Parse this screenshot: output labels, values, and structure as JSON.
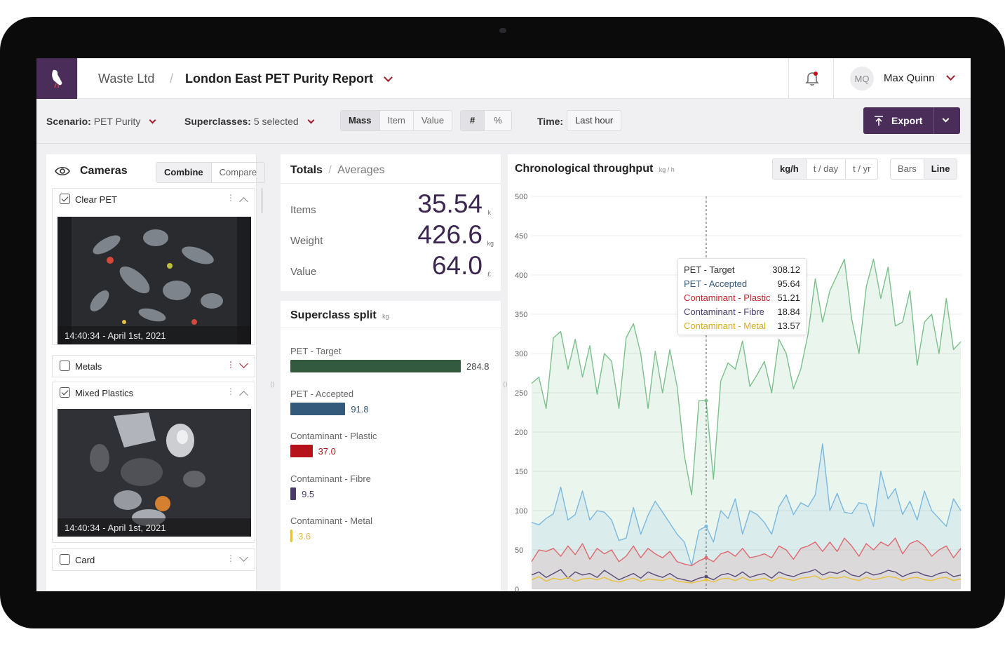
{
  "header": {
    "org": "Waste Ltd",
    "separator": "/",
    "report_title": "London East PET Purity Report",
    "user_initials": "MQ",
    "user_name": "Max Quinn"
  },
  "filters": {
    "scenario_label": "Scenario:",
    "scenario_value": "PET Purity",
    "superclasses_label": "Superclasses:",
    "superclasses_value": "5 selected",
    "metric_options": [
      "Mass",
      "Item",
      "Value"
    ],
    "metric_selected": "Mass",
    "unit_options": [
      "#",
      "%"
    ],
    "unit_selected": "#",
    "time_label": "Time:",
    "time_value": "Last hour",
    "export_label": "Export"
  },
  "cameras": {
    "title": "Cameras",
    "mode_options": [
      "Combine",
      "Compare"
    ],
    "mode_selected": "Combine",
    "items": [
      {
        "name": "Clear PET",
        "checked": true,
        "expanded": true,
        "timestamp": "14:40:34 - April 1st, 2021"
      },
      {
        "name": "Metals",
        "checked": false,
        "expanded": false
      },
      {
        "name": "Mixed Plastics",
        "checked": true,
        "expanded": true,
        "timestamp": "14:40:34 - April 1st, 2021"
      },
      {
        "name": "Card",
        "checked": false,
        "expanded": false
      }
    ]
  },
  "totals": {
    "tab_active": "Totals",
    "tab_separator": "/",
    "tab_inactive": "Averages",
    "rows": [
      {
        "label": "Items",
        "value": "35.54",
        "unit": "k"
      },
      {
        "label": "Weight",
        "value": "426.6",
        "unit": "kg"
      },
      {
        "label": "Value",
        "value": "64.0",
        "unit": "£"
      }
    ]
  },
  "superclass_split": {
    "title": "Superclass split",
    "unit": "kg",
    "max": 284.8,
    "items": [
      {
        "name": "PET - Target",
        "value": 284.8,
        "label": "284.8",
        "color": "#335a3f",
        "label_color": "#444444"
      },
      {
        "name": "PET - Accepted",
        "value": 91.8,
        "label": "91.8",
        "color": "#335a7a",
        "label_color": "#335a7a"
      },
      {
        "name": "Contaminant - Plastic",
        "value": 37.0,
        "label": "37.0",
        "color": "#b5121b",
        "label_color": "#b5121b"
      },
      {
        "name": "Contaminant - Fibre",
        "value": 9.5,
        "label": "9.5",
        "color": "#4a3a6a",
        "label_color": "#4a3a6a"
      },
      {
        "name": "Contaminant - Metal",
        "value": 3.6,
        "label": "3.6",
        "color": "#e8c040",
        "label_color": "#e0b840"
      }
    ]
  },
  "throughput": {
    "title": "Chronological throughput",
    "unit": "kg / h",
    "unit_options": [
      "kg/h",
      "t / day",
      "t / yr"
    ],
    "unit_selected": "kg/h",
    "view_options": [
      "Bars",
      "Line"
    ],
    "view_selected": "Line",
    "tooltip": [
      {
        "name": "PET - Target",
        "value": "308.12",
        "color": "#333333"
      },
      {
        "name": "PET - Accepted",
        "value": "95.64",
        "color": "#335a7a"
      },
      {
        "name": "Contaminant - Plastic",
        "value": "51.21",
        "color": "#c0282f"
      },
      {
        "name": "Contaminant - Fibre",
        "value": "18.84",
        "color": "#4a3a6a"
      },
      {
        "name": "Contaminant - Metal",
        "value": "13.57",
        "color": "#d8ac20"
      }
    ]
  },
  "chart_data": {
    "type": "line",
    "ylim": [
      0,
      500
    ],
    "y_ticks": [
      0,
      50,
      100,
      150,
      200,
      250,
      300,
      350,
      400,
      450,
      500
    ],
    "highlight_index": 24,
    "series": [
      {
        "name": "PET - Target",
        "color": "#7cc08c",
        "fill": "rgba(124,192,140,0.16)",
        "values": [
          262,
          270,
          230,
          320,
          328,
          280,
          318,
          270,
          310,
          248,
          300,
          290,
          230,
          320,
          338,
          300,
          230,
          303,
          250,
          305,
          258,
          170,
          120,
          240,
          240,
          140,
          265,
          288,
          280,
          316,
          258,
          273,
          290,
          250,
          318,
          300,
          255,
          280,
          325,
          395,
          340,
          380,
          400,
          420,
          344,
          300,
          385,
          420,
          370,
          410,
          335,
          340,
          380,
          285,
          340,
          350,
          300,
          370,
          305,
          315
        ]
      },
      {
        "name": "PET - Accepted",
        "color": "#7bb8e0",
        "fill": "rgba(123,184,224,0.14)",
        "values": [
          85,
          82,
          90,
          96,
          130,
          88,
          95,
          125,
          88,
          100,
          98,
          88,
          62,
          65,
          104,
          70,
          94,
          112,
          98,
          84,
          70,
          60,
          30,
          75,
          80,
          60,
          100,
          90,
          115,
          70,
          100,
          95,
          85,
          70,
          105,
          120,
          95,
          110,
          105,
          120,
          185,
          100,
          122,
          98,
          96,
          110,
          108,
          80,
          150,
          115,
          128,
          95,
          112,
          88,
          125,
          100,
          90,
          80,
          115,
          100
        ]
      },
      {
        "name": "Contaminant - Plastic",
        "color": "#e06870",
        "fill": "rgba(224,104,112,0.14)",
        "values": [
          35,
          50,
          48,
          52,
          42,
          55,
          44,
          58,
          38,
          52,
          45,
          50,
          35,
          42,
          55,
          40,
          52,
          45,
          40,
          48,
          35,
          32,
          30,
          36,
          40,
          35,
          45,
          48,
          42,
          52,
          40,
          42,
          45,
          40,
          55,
          50,
          38,
          52,
          55,
          60,
          48,
          60,
          48,
          65,
          55,
          42,
          58,
          50,
          60,
          55,
          65,
          45,
          58,
          62,
          55,
          42,
          50,
          55,
          40,
          52
        ]
      },
      {
        "name": "Contaminant - Fibre",
        "color": "#5a4a78",
        "values": [
          18,
          22,
          15,
          20,
          25,
          14,
          22,
          18,
          20,
          15,
          24,
          18,
          12,
          16,
          20,
          14,
          22,
          18,
          15,
          20,
          14,
          12,
          10,
          14,
          16,
          12,
          18,
          20,
          16,
          22,
          15,
          18,
          20,
          14,
          22,
          18,
          16,
          20,
          22,
          25,
          18,
          22,
          20,
          24,
          18,
          16,
          22,
          18,
          20,
          24,
          22,
          16,
          20,
          22,
          18,
          16,
          20,
          22,
          16,
          18
        ]
      },
      {
        "name": "Contaminant - Metal",
        "color": "#e8c040",
        "values": [
          12,
          16,
          10,
          14,
          12,
          15,
          10,
          13,
          14,
          12,
          15,
          11,
          9,
          12,
          14,
          10,
          13,
          12,
          11,
          14,
          10,
          9,
          8,
          10,
          12,
          9,
          13,
          14,
          11,
          15,
          11,
          12,
          14,
          10,
          15,
          13,
          11,
          14,
          15,
          17,
          12,
          15,
          14,
          16,
          13,
          11,
          15,
          12,
          14,
          16,
          15,
          11,
          14,
          15,
          12,
          11,
          14,
          15,
          11,
          13
        ]
      }
    ]
  }
}
